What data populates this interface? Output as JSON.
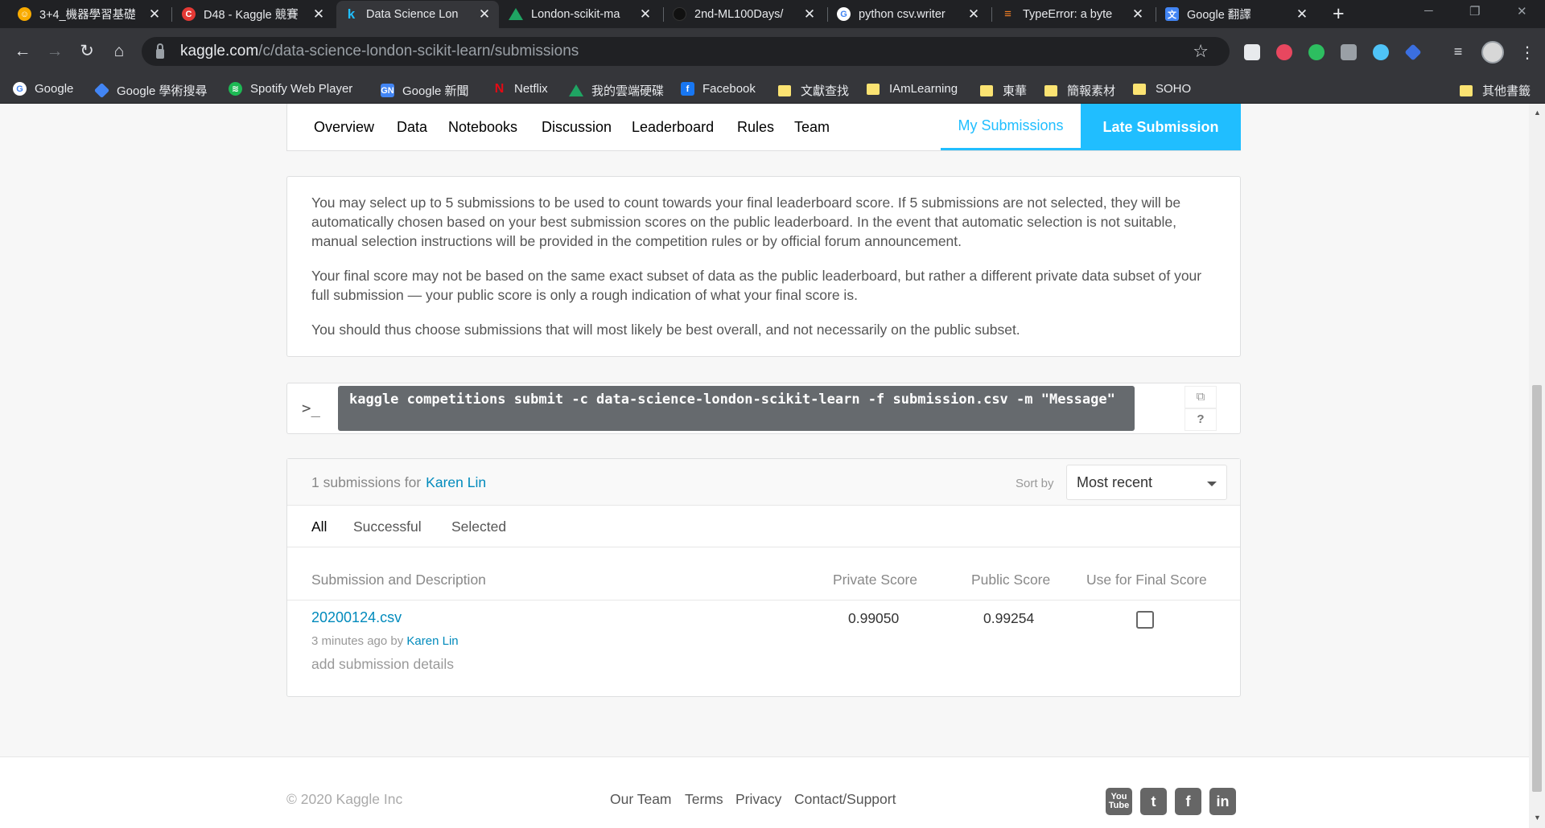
{
  "browser": {
    "tabs": [
      {
        "title": "3+4_機器學習基礎",
        "icon": "cupola-icon",
        "color": "#f9ab00"
      },
      {
        "title": "D48 - Kaggle 競賽",
        "icon": "cupoy-icon",
        "color": "#e53935"
      },
      {
        "title": "Data Science Lon",
        "icon": "kaggle-icon",
        "color": "#20beff"
      },
      {
        "title": "London-scikit-ma",
        "icon": "drive-icon",
        "color": "#1fa463"
      },
      {
        "title": "2nd-ML100Days/",
        "icon": "github-icon",
        "color": "#202124"
      },
      {
        "title": "python csv.writer",
        "icon": "google-icon",
        "color": "#4285f4"
      },
      {
        "title": "TypeError: a byte",
        "icon": "stackoverflow-icon",
        "color": "#f48024"
      },
      {
        "title": "Google 翻譯",
        "icon": "translate-icon",
        "color": "#4285f4"
      }
    ],
    "close_glyph": "✕",
    "new_tab_glyph": "+",
    "url_host": "kaggle.com",
    "url_path": "/c/data-science-london-scikit-learn/submissions",
    "bookmarks": [
      {
        "label": "Google",
        "icon": "google-icon",
        "color": "#4285f4"
      },
      {
        "label": "Google 學術搜尋",
        "icon": "scholar-icon",
        "color": "#4285f4"
      },
      {
        "label": "Spotify Web Player",
        "icon": "spotify-icon",
        "color": "#1db954"
      },
      {
        "label": "Google 新聞",
        "icon": "news-icon",
        "color": "#4285f4"
      },
      {
        "label": "Netflix",
        "icon": "netflix-icon",
        "color": "#e50914"
      },
      {
        "label": "我的雲端硬碟",
        "icon": "drive-icon",
        "color": "#1fa463"
      },
      {
        "label": "Facebook",
        "icon": "facebook-icon",
        "color": "#1877f2"
      },
      {
        "label": "文獻查找",
        "icon": "folder-icon"
      },
      {
        "label": "IAmLearning",
        "icon": "folder-icon"
      },
      {
        "label": "東華",
        "icon": "folder-icon"
      },
      {
        "label": "簡報素材",
        "icon": "folder-icon"
      },
      {
        "label": "SOHO",
        "icon": "folder-icon"
      }
    ],
    "other_bookmarks": "其他書籤"
  },
  "nav": {
    "items": [
      "Overview",
      "Data",
      "Notebooks",
      "Discussion",
      "Leaderboard",
      "Rules",
      "Team"
    ],
    "my_submissions": "My Submissions",
    "late_submission": "Late Submission"
  },
  "info": {
    "p1": "You may select up to 5 submissions to be used to count towards your final leaderboard score. If 5 submissions are not selected, they will be automatically chosen based on your best submission scores on the public leaderboard. In the event that automatic selection is not suitable, manual selection instructions will be provided in the competition rules or by official forum announcement.",
    "p2": "Your final score may not be based on the same exact subset of data as the public leaderboard, but rather a different private data subset of your full submission — your public score is only a rough indication of what your final score is.",
    "p3": "You should thus choose submissions that will most likely be best overall, and not necessarily on the public subset."
  },
  "command": {
    "prompt": ">_",
    "text": "kaggle competitions submit -c data-science-london-scikit-learn -f submission.csv -m \"Message\"",
    "help": "?"
  },
  "submissions": {
    "count_text": "1 submissions for",
    "owner": "Karen Lin",
    "sort_label": "Sort by",
    "sort_value": "Most recent",
    "filters": [
      "All",
      "Successful",
      "Selected"
    ],
    "columns": {
      "desc": "Submission and Description",
      "private": "Private Score",
      "public": "Public Score",
      "final": "Use for Final Score"
    },
    "rows": [
      {
        "file": "20200124.csv",
        "time": "3 minutes ago by",
        "author": "Karen Lin",
        "details": "add submission details",
        "private": "0.99050",
        "public": "0.99254",
        "selected": false
      }
    ]
  },
  "footer": {
    "copyright": "© 2020 Kaggle Inc",
    "links": [
      "Our Team",
      "Terms",
      "Privacy",
      "Contact/Support"
    ],
    "social": [
      "youtube-icon",
      "twitter-icon",
      "facebook-icon",
      "linkedin-icon"
    ]
  }
}
